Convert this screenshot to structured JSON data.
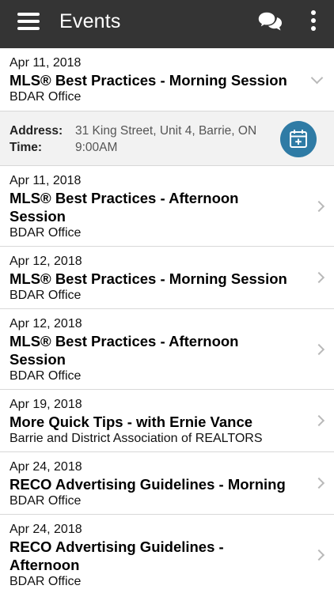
{
  "header": {
    "title": "Events",
    "icons": [
      "menu-icon",
      "chat-icon",
      "more-vertical-icon"
    ],
    "background": "#343434"
  },
  "expanded": {
    "address_label": "Address:",
    "address": "31 King Street, Unit 4, Barrie, ON",
    "time_label": "Time:",
    "time": "9:00AM",
    "action_icon": "add-to-calendar-icon",
    "action_color": "#2f7ba5"
  },
  "events": [
    {
      "date": "Apr 11, 2018",
      "name": "MLS® Best Practices - Morning Session",
      "venue": "BDAR Office",
      "expanded": true
    },
    {
      "date": "Apr 11, 2018",
      "name": "MLS® Best Practices - Afternoon Session",
      "venue": "BDAR Office"
    },
    {
      "date": "Apr 12, 2018",
      "name": "MLS® Best Practices - Morning Session",
      "venue": "BDAR Office"
    },
    {
      "date": "Apr 12, 2018",
      "name": "MLS® Best Practices - Afternoon Session",
      "venue": "BDAR Office"
    },
    {
      "date": "Apr 19, 2018",
      "name": "More Quick Tips - with Ernie Vance",
      "venue": "Barrie and District Association of REALTORS"
    },
    {
      "date": "Apr 24, 2018",
      "name": "RECO Advertising Guidelines - Morning",
      "venue": "BDAR Office"
    },
    {
      "date": "Apr 24, 2018",
      "name": "RECO Advertising Guidelines - Afternoon",
      "venue": "BDAR Office"
    }
  ]
}
